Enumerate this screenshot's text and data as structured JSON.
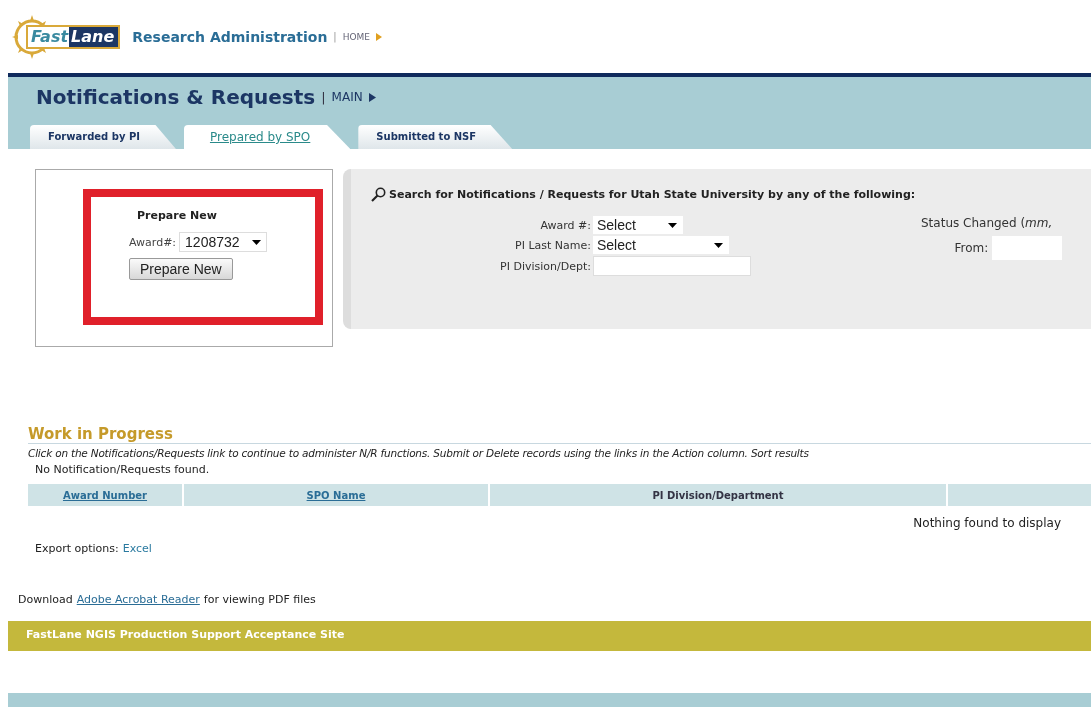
{
  "header": {
    "logo": [
      "Fast",
      "Lane"
    ],
    "site_title": "Research Administration",
    "separator": "|",
    "home_link": "HOME"
  },
  "section": {
    "title": "Notifications & Requests",
    "separator": "|",
    "main_link": "MAIN"
  },
  "tabs": [
    {
      "label": "Forwarded by PI",
      "selected": false
    },
    {
      "label": "Prepared by SPO",
      "selected": true
    },
    {
      "label": "Submitted to NSF",
      "selected": false
    }
  ],
  "prepare_panel": {
    "title": "Prepare New",
    "award_label": "Award#:",
    "award_value": "1208732",
    "button": "Prepare New",
    "highlighted": true
  },
  "search_panel": {
    "title": "Search for Notifications / Requests for Utah State University by any of the following:",
    "fields": [
      {
        "label": "Award #:",
        "kind": "select",
        "value": "Select"
      },
      {
        "label": "PI Last Name:",
        "kind": "select",
        "value": "Select"
      },
      {
        "label": "PI Division/Dept:",
        "kind": "text"
      }
    ],
    "status_changed_label": "Status Changed (*mm,*",
    "from_label": "From:"
  },
  "work_in_progress": {
    "title": "Work in Progress",
    "instructions": "Click on the Notifications/Requests link to continue to administer N/R functions. Submit or Delete records using the links in the Action column. Sort results",
    "empty_message": "No Notification/Requests found.",
    "columns": [
      {
        "label": "Award Number",
        "sortable": true
      },
      {
        "label": "SPO Name",
        "sortable": true
      },
      {
        "label": "PI Division/Department",
        "sortable": false
      }
    ],
    "nothing_found": "Nothing found to display",
    "export_label": "Export options:",
    "export_link": "Excel"
  },
  "download": {
    "before": "Download",
    "link": "Adobe Acrobat Reader",
    "after": "for viewing PDF files"
  },
  "footer": {
    "banner": "FastLane NGIS Production Support Acceptance Site"
  }
}
